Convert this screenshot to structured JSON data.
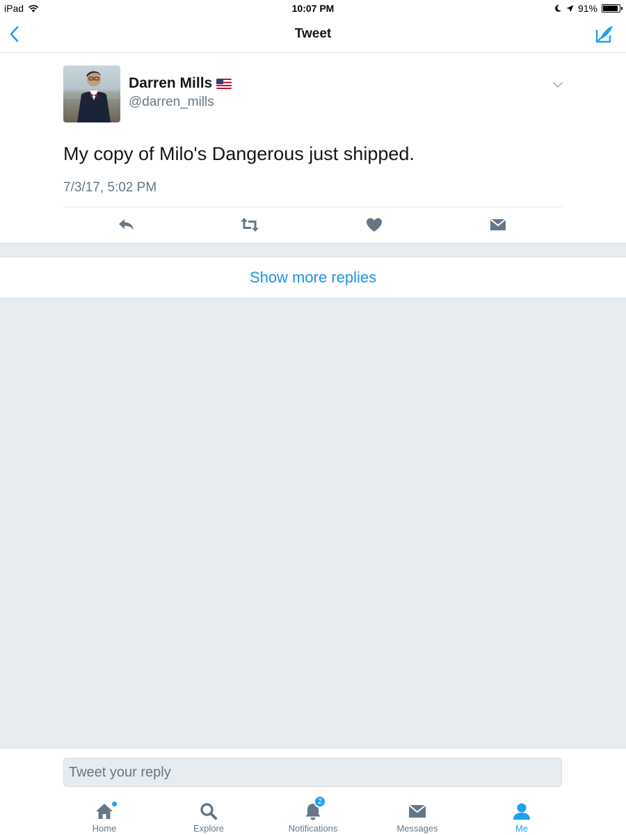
{
  "status_bar": {
    "device": "iPad",
    "time": "10:07 PM",
    "battery": "91%",
    "battery_level": 0.91
  },
  "nav": {
    "title": "Tweet",
    "back_icon": "chevron-left-icon",
    "compose_icon": "compose-icon"
  },
  "tweet": {
    "author_name": "Darren Mills",
    "flag_icon": "us-flag-icon",
    "handle": "@darren_mills",
    "text": "My copy of Milo's Dangerous just shipped.",
    "timestamp": "7/3/17, 5:02 PM",
    "actions": [
      "reply-icon",
      "retweet-icon",
      "like-icon",
      "direct-message-icon"
    ]
  },
  "show_more": {
    "label": "Show more replies"
  },
  "reply": {
    "placeholder": "Tweet your reply"
  },
  "tabs": [
    {
      "label": "Home",
      "icon": "home-icon",
      "active": false,
      "indicator_dot": true
    },
    {
      "label": "Explore",
      "icon": "search-icon",
      "active": false
    },
    {
      "label": "Notifications",
      "icon": "bell-icon",
      "active": false,
      "badge": "2"
    },
    {
      "label": "Messages",
      "icon": "envelope-icon",
      "active": false
    },
    {
      "label": "Me",
      "icon": "person-icon",
      "active": true
    }
  ],
  "colors": {
    "accent": "#1da1f2",
    "link": "#1b95e0",
    "secondary_text": "#657786",
    "background": "#e6ecf0"
  }
}
